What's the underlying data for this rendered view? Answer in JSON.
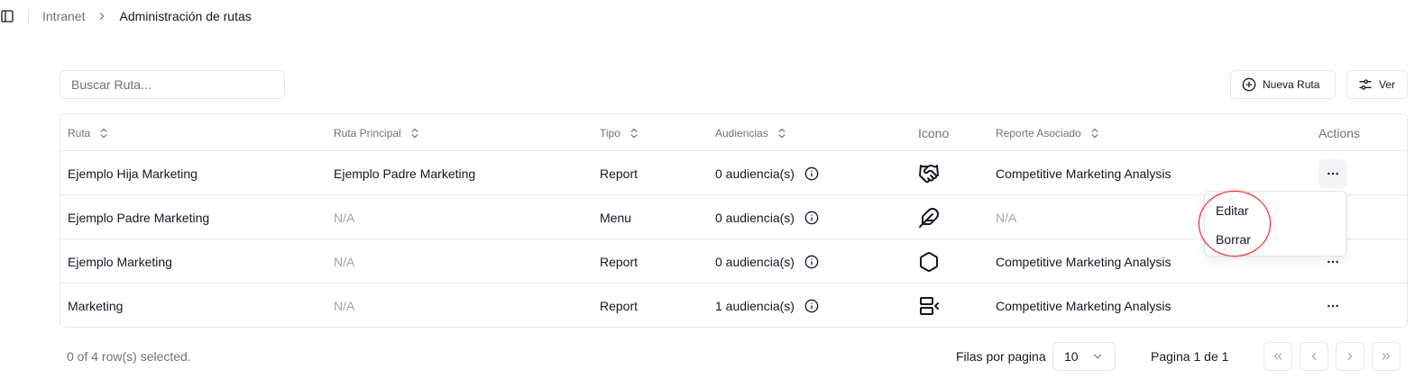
{
  "breadcrumb": {
    "parent": "Intranet",
    "current": "Administración de rutas"
  },
  "toolbar": {
    "search_placeholder": "Buscar Ruta...",
    "new_route_label": "Nueva Ruta",
    "view_label": "Ver"
  },
  "table": {
    "headers": {
      "ruta": "Ruta",
      "ruta_principal": "Ruta Principal",
      "tipo": "Tipo",
      "audiencias": "Audiencias",
      "icono": "Icono",
      "reporte": "Reporte Asociado",
      "actions": "Actions"
    },
    "rows": [
      {
        "ruta": "Ejemplo Hija Marketing",
        "principal": "Ejemplo Padre Marketing",
        "tipo": "Report",
        "audiencias": "0 audiencia(s)",
        "icon": "handshake-icon",
        "reporte": "Competitive Marketing Analysis"
      },
      {
        "ruta": "Ejemplo Padre Marketing",
        "principal": "N/A",
        "tipo": "Menu",
        "audiencias": "0 audiencia(s)",
        "icon": "feather-icon",
        "reporte": "N/A"
      },
      {
        "ruta": "Ejemplo Marketing",
        "principal": "N/A",
        "tipo": "Report",
        "audiencias": "0 audiencia(s)",
        "icon": "hexagon-icon",
        "reporte": "Competitive Marketing Analysis"
      },
      {
        "ruta": "Marketing",
        "principal": "N/A",
        "tipo": "Report",
        "audiencias": "1 audiencia(s)",
        "icon": "between-horizontal-icon",
        "reporte": "Competitive Marketing Analysis"
      }
    ]
  },
  "row_menu": {
    "edit": "Editar",
    "delete": "Borrar"
  },
  "footer": {
    "selected": "0 of 4 row(s) selected.",
    "rows_per_page_label": "Filas por pagina",
    "rows_per_page_value": "10",
    "page_info": "Pagina 1 de 1"
  },
  "colors": {
    "border": "#e5e7eb",
    "muted": "#6b7280",
    "na": "#9ca3af",
    "highlight": "#e02424"
  }
}
